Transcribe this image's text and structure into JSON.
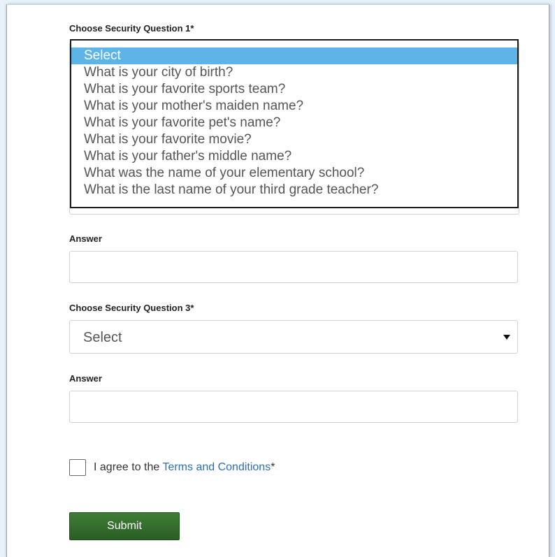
{
  "form": {
    "question1": {
      "label": "Choose Security Question 1*",
      "options": [
        "Select",
        "What is your city of birth?",
        "What is your favorite sports team?",
        "What is your mother's maiden name?",
        "What is your favorite pet's name?",
        "What is your favorite movie?",
        "What is your father's middle name?",
        "What was the name of your elementary school?",
        "What is the last name of your third grade teacher?"
      ],
      "selected": "Select"
    },
    "answer1": {
      "label": "Answer",
      "value": "",
      "placeholder": ""
    },
    "question3": {
      "label": "Choose Security Question 3*",
      "selected": "Select"
    },
    "answer3": {
      "label": "Answer",
      "value": "",
      "placeholder": ""
    },
    "terms": {
      "prefix": "I agree to the ",
      "link": "Terms and Conditions",
      "suffix": "*",
      "checked": false
    },
    "submit_label": "Submit"
  },
  "colors": {
    "selected_option_bg": "#5db4e6",
    "link": "#2a6ebb",
    "submit_bg": "#2f6a2a"
  }
}
